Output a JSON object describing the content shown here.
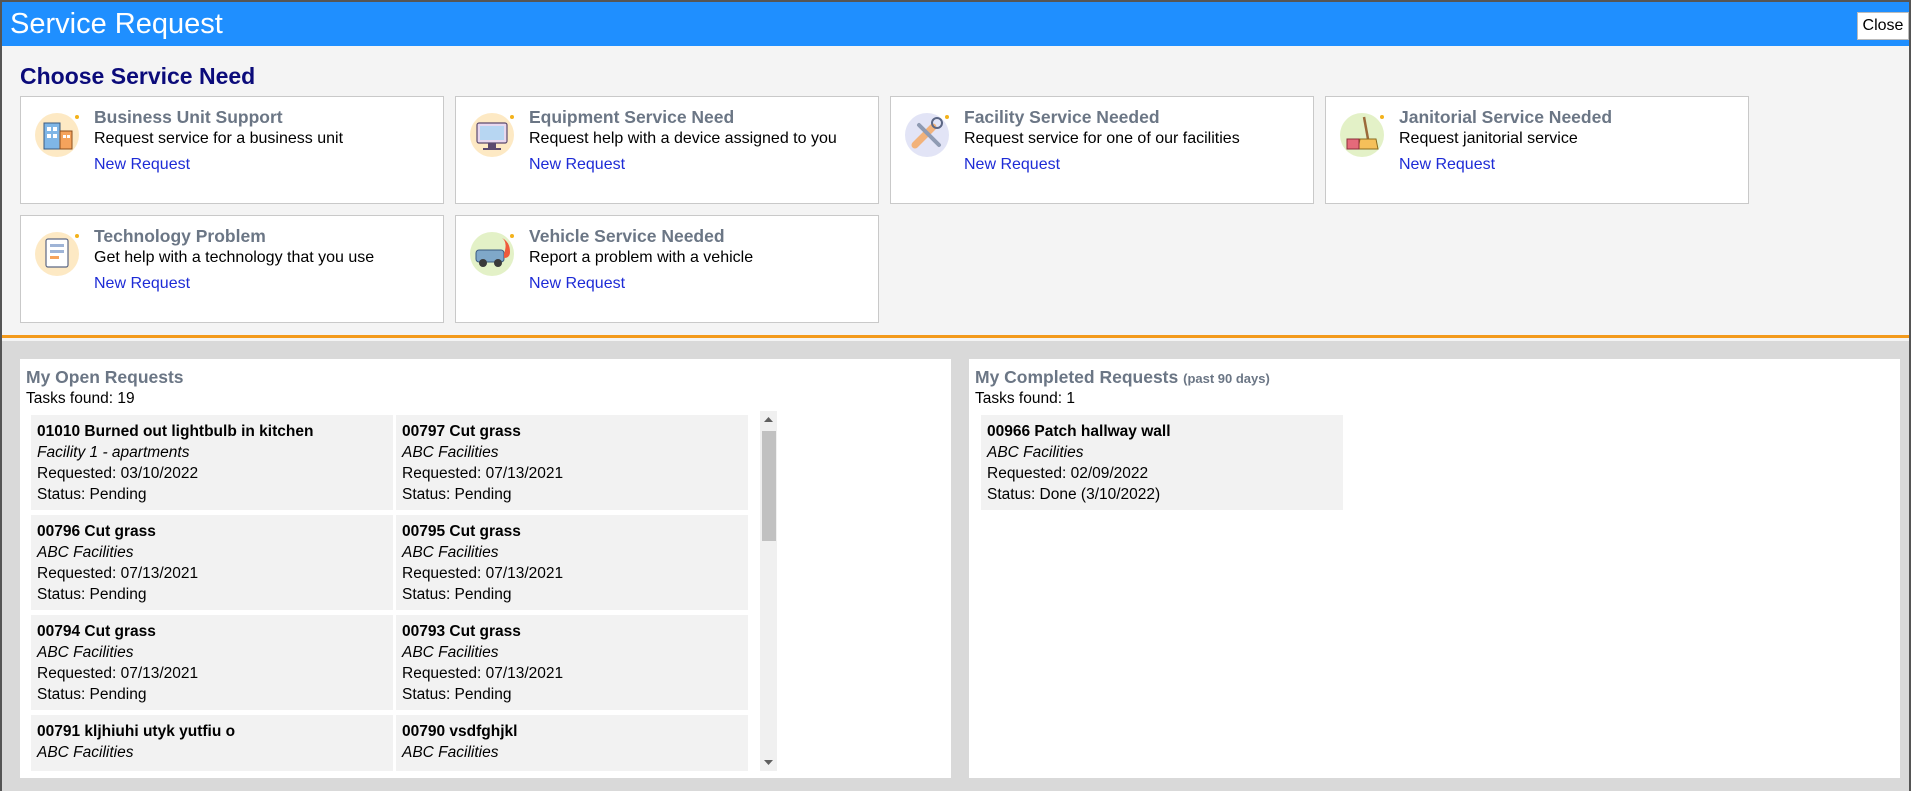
{
  "window": {
    "title": "Service Request",
    "close_label": "Close"
  },
  "choose": {
    "heading": "Choose Service Need",
    "cards": [
      {
        "title": "Business Unit Support",
        "description": "Request service for a business unit",
        "link": "New Request",
        "icon": "business-unit-icon"
      },
      {
        "title": "Equipment Service Need",
        "description": "Request help with a device assigned to you",
        "link": "New Request",
        "icon": "equipment-icon"
      },
      {
        "title": "Facility Service Needed",
        "description": "Request service for one of our facilities",
        "link": "New Request",
        "icon": "facility-tools-icon"
      },
      {
        "title": "Janitorial Service Needed",
        "description": "Request janitorial service",
        "link": "New Request",
        "icon": "janitorial-icon"
      },
      {
        "title": "Technology Problem",
        "description": "Get help with a technology that you use",
        "link": "New Request",
        "icon": "technology-icon"
      },
      {
        "title": "Vehicle Service Needed",
        "description": "Report a problem with a vehicle",
        "link": "New Request",
        "icon": "vehicle-icon"
      }
    ]
  },
  "open_requests": {
    "title": "My Open Requests",
    "count_text": "Tasks found: 19",
    "tasks": [
      {
        "id_title": "01010  Burned out lightbulb in kitchen",
        "location": "Facility 1 - apartments",
        "requested": "Requested: 03/10/2022",
        "status": "Status: Pending"
      },
      {
        "id_title": "00797  Cut grass",
        "location": "ABC Facilities",
        "requested": "Requested: 07/13/2021",
        "status": "Status: Pending"
      },
      {
        "id_title": "00796  Cut grass",
        "location": "ABC Facilities",
        "requested": "Requested: 07/13/2021",
        "status": "Status: Pending"
      },
      {
        "id_title": "00795  Cut grass",
        "location": "ABC Facilities",
        "requested": "Requested: 07/13/2021",
        "status": "Status: Pending"
      },
      {
        "id_title": "00794  Cut grass",
        "location": "ABC Facilities",
        "requested": "Requested: 07/13/2021",
        "status": "Status: Pending"
      },
      {
        "id_title": "00793  Cut grass",
        "location": "ABC Facilities",
        "requested": "Requested: 07/13/2021",
        "status": "Status: Pending"
      },
      {
        "id_title": "00791  kljhiuhi utyk yutfiu o",
        "location": "ABC Facilities",
        "requested": "",
        "status": ""
      },
      {
        "id_title": "00790  vsdfghjkl",
        "location": "ABC Facilities",
        "requested": "",
        "status": ""
      }
    ]
  },
  "completed_requests": {
    "title": "My Completed Requests",
    "title_suffix": "(past 90 days)",
    "count_text": "Tasks found: 1",
    "tasks": [
      {
        "id_title": "00966  Patch hallway wall",
        "location": "ABC Facilities",
        "requested": "Requested: 02/09/2022",
        "status": "Status: Done (3/10/2022)"
      }
    ]
  },
  "colors": {
    "title_bar": "#1f8fff",
    "accent_orange": "#f39a1c",
    "heading_navy": "#0b0b7a",
    "link_blue": "#1d2bd6",
    "card_title_gray": "#6b7685"
  }
}
